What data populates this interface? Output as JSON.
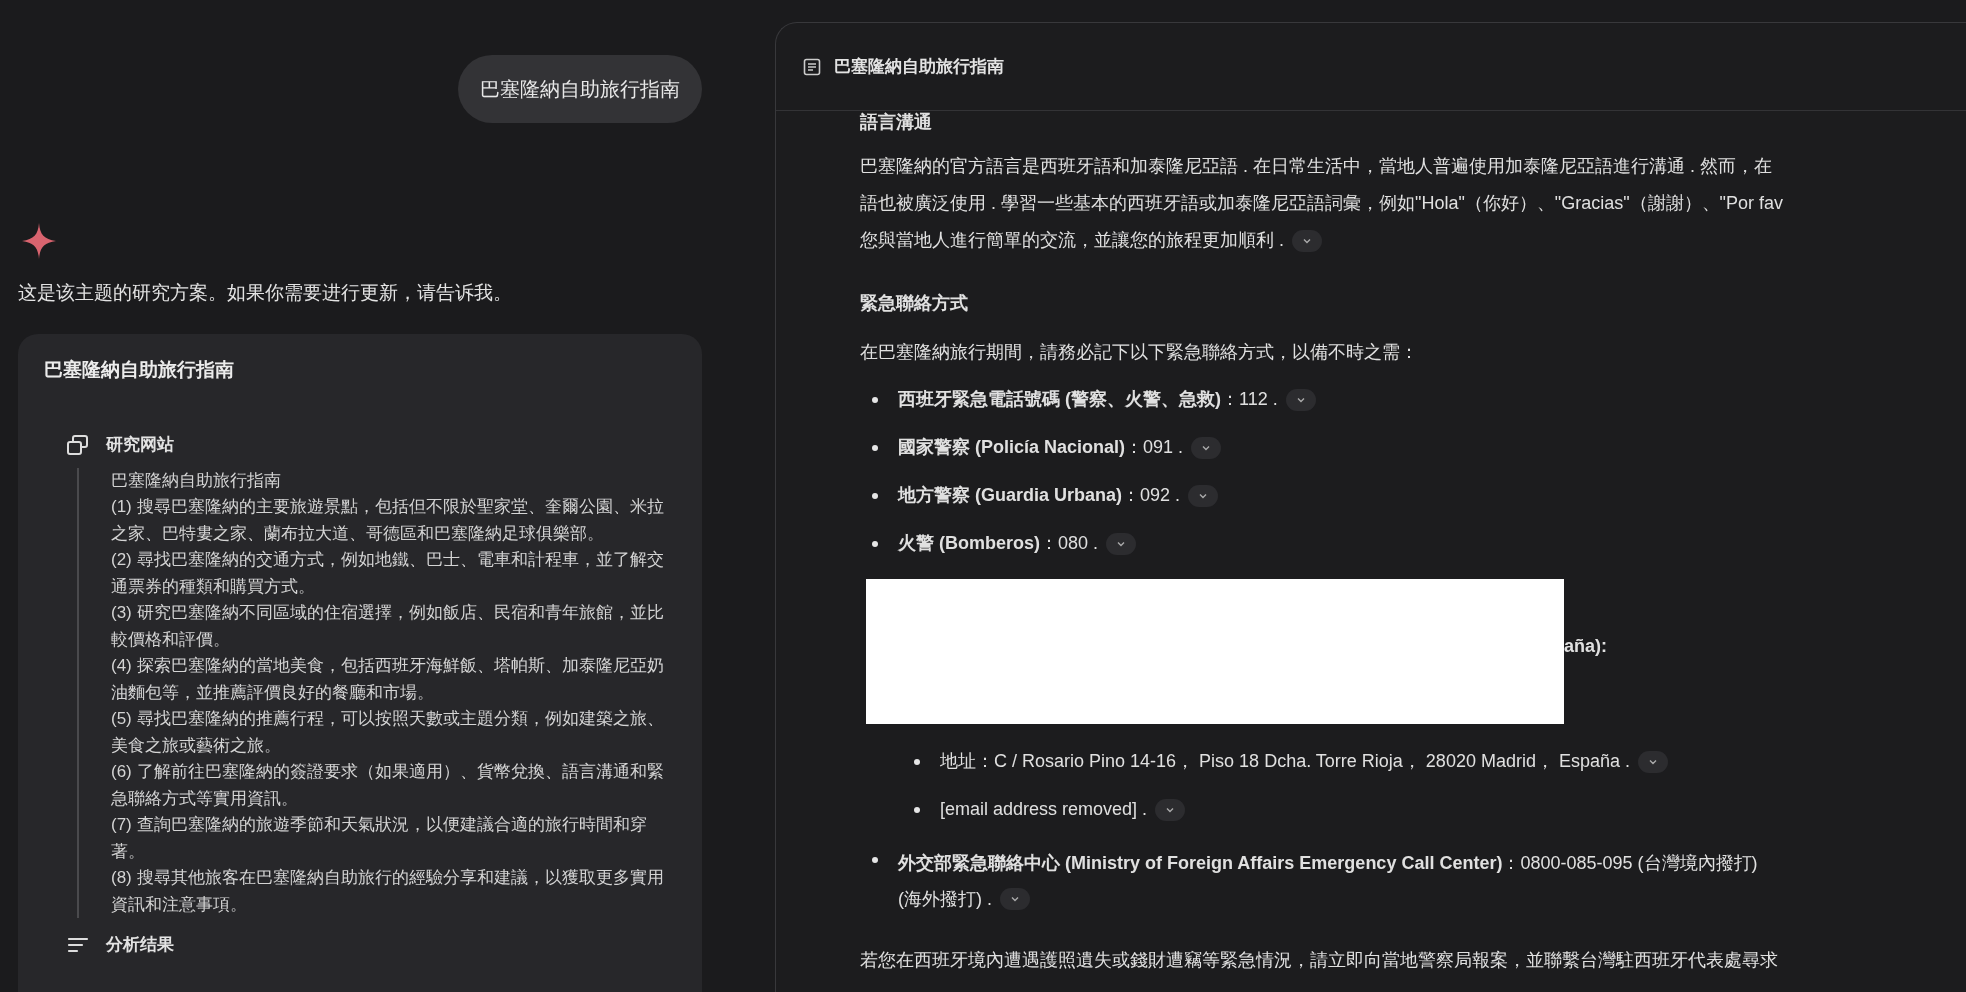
{
  "user_message": "巴塞隆納自助旅行指南",
  "assistant": {
    "intro": "这是该主题的研究方案。如果你需要进行更新，请告诉我。",
    "plan_card": {
      "title": "巴塞隆納自助旅行指南",
      "steps": [
        {
          "kind": "research",
          "label": "研究网站",
          "lines": [
            "巴塞隆納自助旅行指南",
            "(1) 搜尋巴塞隆納的主要旅遊景點，包括但不限於聖家堂、奎爾公園、米拉之家、巴特婁之家、蘭布拉大道、哥德區和巴塞隆納足球俱樂部。",
            "(2) 尋找巴塞隆納的交通方式，例如地鐵、巴士、電車和計程車，並了解交通票券的種類和購買方式。",
            "(3) 研究巴塞隆納不同區域的住宿選擇，例如飯店、民宿和青年旅館，並比較價格和評價。",
            "(4) 探索巴塞隆納的當地美食，包括西班牙海鮮飯、塔帕斯、加泰隆尼亞奶油麵包等，並推薦評價良好的餐廳和市場。",
            "(5) 尋找巴塞隆納的推薦行程，可以按照天數或主題分類，例如建築之旅、美食之旅或藝術之旅。",
            "(6) 了解前往巴塞隆納的簽證要求（如果適用）、貨幣兌換、語言溝通和緊急聯絡方式等實用資訊。",
            "(7) 查詢巴塞隆納的旅遊季節和天氣狀況，以便建議合適的旅行時間和穿著。",
            "(8) 搜尋其他旅客在巴塞隆納自助旅行的經驗分享和建議，以獲取更多實用資訊和注意事項。"
          ]
        },
        {
          "kind": "analysis",
          "label": "分析结果"
        }
      ]
    }
  },
  "document": {
    "title": "巴塞隆納自助旅行指南",
    "language_heading": "語言溝通",
    "language_lines": [
      "巴塞隆納的官方語言是西班牙語和加泰隆尼亞語 . 在日常生活中，當地人普遍使用加泰隆尼亞語進行溝通 . 然而，在",
      "語也被廣泛使用 . 學習一些基本的西班牙語或加泰隆尼亞語詞彙，例如\"Hola\"（你好）、\"Gracias\"（謝謝）、\"Por fav",
      "您與當地人進行簡單的交流，並讓您的旅程更加順利 ."
    ],
    "language_source": true,
    "emergency_heading": "緊急聯絡方式",
    "emergency_intro": "在巴塞隆納旅行期間，請務必記下以下緊急聯絡方式，以備不時之需：",
    "contacts": [
      {
        "label": "西班牙緊急電話號碼 (警察、火警、急救)",
        "value": "：112 .",
        "source": true
      },
      {
        "label": "國家警察 (Policía Nacional)",
        "value": "：091 .",
        "source": true
      },
      {
        "label": "地方警察 (Guardia Urbana)",
        "value": "：092 .",
        "source": true
      },
      {
        "label": "火警 (Bomberos)",
        "value": "：080 .",
        "source": true
      }
    ],
    "hidden_fragment": "aña):",
    "sub_items": [
      {
        "text": "地址：C / Rosario Pino 14-16， Piso 18 Dcha.   Torre Rioja， 28020 Madrid， España .",
        "source": true
      },
      {
        "text": "[email address removed] .",
        "source": true
      }
    ],
    "foreign_affairs": {
      "label": "外交部緊急聯絡中心 (Ministry of Foreign Affairs Emergency Call Center)",
      "value": "：0800-085-095 (台灣境內撥打)",
      "continuation": "(海外撥打) .",
      "source": true
    },
    "closing": "若您在西班牙境內遭遇護照遺失或錢財遭竊等緊急情況，請立即向當地警察局報案，並聯繫台灣駐西班牙代表處尋求"
  }
}
